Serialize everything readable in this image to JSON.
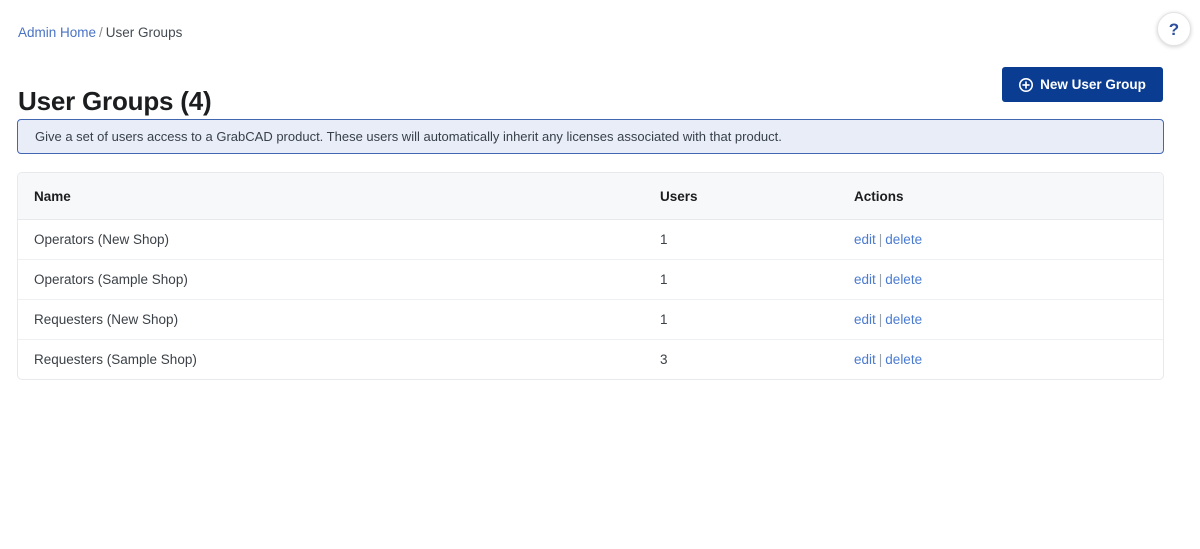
{
  "help": {
    "label": "?"
  },
  "breadcrumb": {
    "home_label": "Admin Home",
    "separator": "/",
    "current_label": "User Groups"
  },
  "header": {
    "title": "User Groups (4)",
    "new_button_label": "New User Group"
  },
  "banner": {
    "text": "Give a set of users access to a GrabCAD product. These users will automatically inherit any licenses associated with that product."
  },
  "table": {
    "columns": {
      "name": "Name",
      "users": "Users",
      "actions": "Actions"
    },
    "actions": {
      "edit_label": "edit",
      "separator": "|",
      "delete_label": "delete"
    },
    "rows": [
      {
        "name": "Operators (New Shop)",
        "users": "1"
      },
      {
        "name": "Operators (Sample Shop)",
        "users": "1"
      },
      {
        "name": "Requesters (New Shop)",
        "users": "1"
      },
      {
        "name": "Requesters (Sample Shop)",
        "users": "3"
      }
    ]
  },
  "colors": {
    "primary_button": "#0a3d91",
    "link": "#4a7bd0",
    "banner_bg": "#e9edf7",
    "banner_border": "#4267b2",
    "header_row_bg": "#f7f8fa"
  }
}
